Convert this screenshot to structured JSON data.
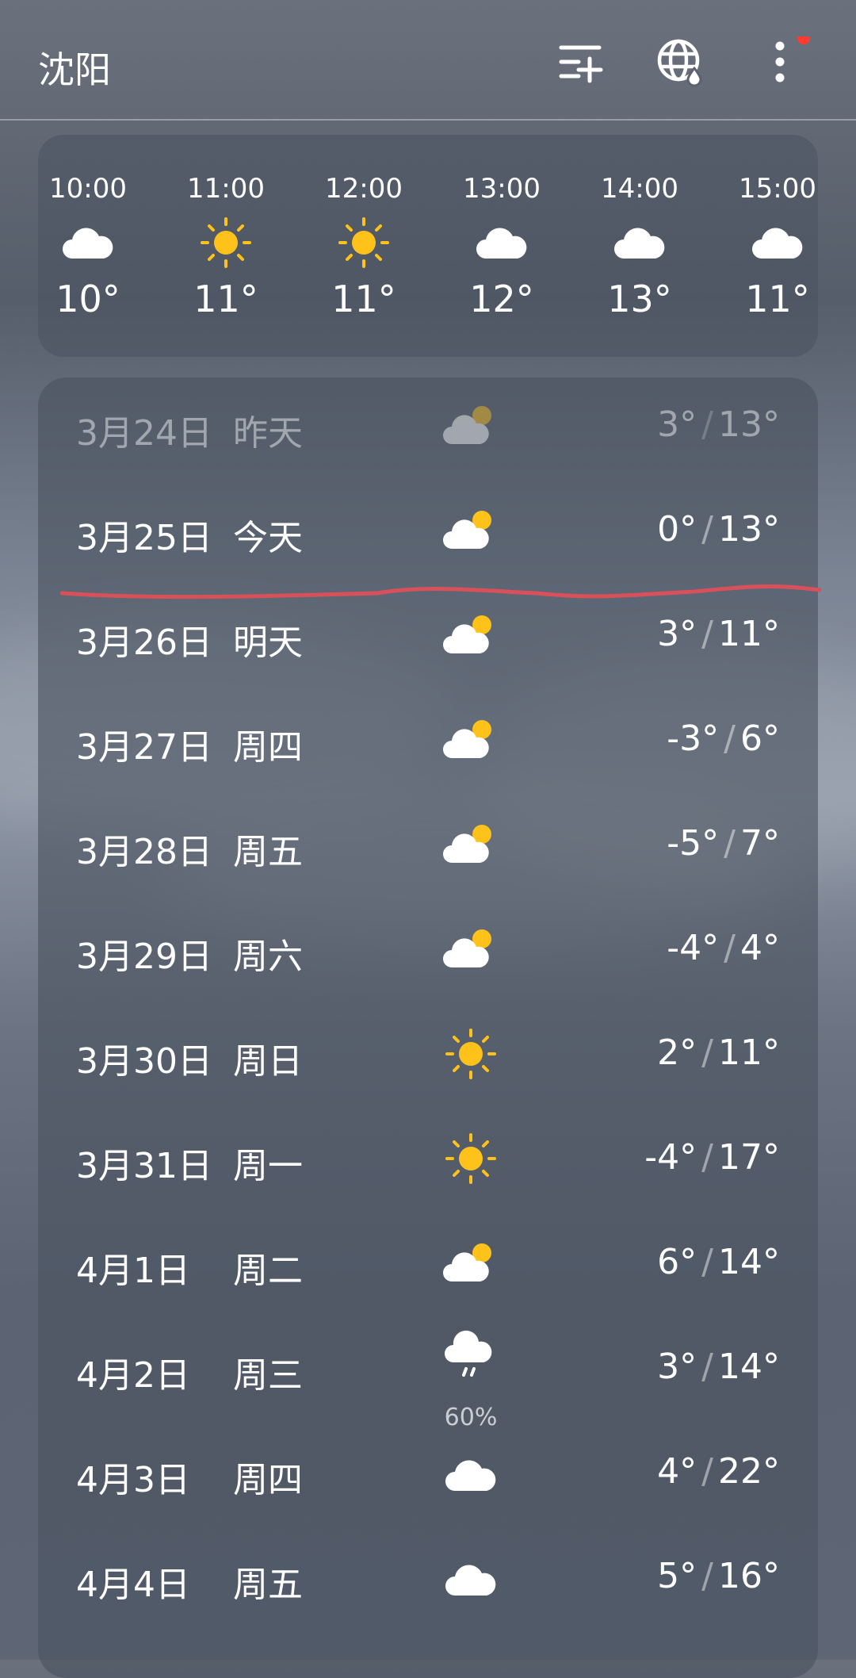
{
  "header": {
    "city": "沈阳",
    "icons": [
      "add-list-icon",
      "globe-icon",
      "more-icon"
    ],
    "notification_dot_color": "#ff3b30"
  },
  "hourly": [
    {
      "time": "10:00",
      "icon": "cloud-icon",
      "temp": "10°"
    },
    {
      "time": "11:00",
      "icon": "sun-icon",
      "temp": "11°"
    },
    {
      "time": "12:00",
      "icon": "sun-icon",
      "temp": "11°"
    },
    {
      "time": "13:00",
      "icon": "cloud-icon",
      "temp": "12°"
    },
    {
      "time": "14:00",
      "icon": "cloud-icon",
      "temp": "13°"
    },
    {
      "time": "15:00",
      "icon": "cloud-icon",
      "temp": "11°"
    }
  ],
  "daily": [
    {
      "date": "3月24日",
      "weekday": "昨天",
      "icon": "partly-cloudy-icon",
      "low": "3°",
      "high": "13°",
      "past": true
    },
    {
      "date": "3月25日",
      "weekday": "今天",
      "icon": "partly-cloudy-icon",
      "low": "0°",
      "high": "13°"
    },
    {
      "date": "3月26日",
      "weekday": "明天",
      "icon": "partly-cloudy-icon",
      "low": "3°",
      "high": "11°"
    },
    {
      "date": "3月27日",
      "weekday": "周四",
      "icon": "partly-cloudy-icon",
      "low": "-3°",
      "high": "6°"
    },
    {
      "date": "3月28日",
      "weekday": "周五",
      "icon": "partly-cloudy-icon",
      "low": "-5°",
      "high": "7°"
    },
    {
      "date": "3月29日",
      "weekday": "周六",
      "icon": "partly-cloudy-icon",
      "low": "-4°",
      "high": "4°"
    },
    {
      "date": "3月30日",
      "weekday": "周日",
      "icon": "sun-icon",
      "low": "2°",
      "high": "11°"
    },
    {
      "date": "3月31日",
      "weekday": "周一",
      "icon": "sun-icon",
      "low": "-4°",
      "high": "17°"
    },
    {
      "date": "4月1日",
      "weekday": "周二",
      "icon": "partly-cloudy-icon",
      "low": "6°",
      "high": "14°"
    },
    {
      "date": "4月2日",
      "weekday": "周三",
      "icon": "rain-icon",
      "precip": "60%",
      "low": "3°",
      "high": "14°"
    },
    {
      "date": "4月3日",
      "weekday": "周四",
      "icon": "cloud-icon",
      "low": "4°",
      "high": "22°"
    },
    {
      "date": "4月4日",
      "weekday": "周五",
      "icon": "cloud-icon",
      "low": "5°",
      "high": "16°"
    }
  ],
  "temp_separator": "/",
  "colors": {
    "sun": "#ffc21a",
    "annotation": "#d8505a"
  }
}
